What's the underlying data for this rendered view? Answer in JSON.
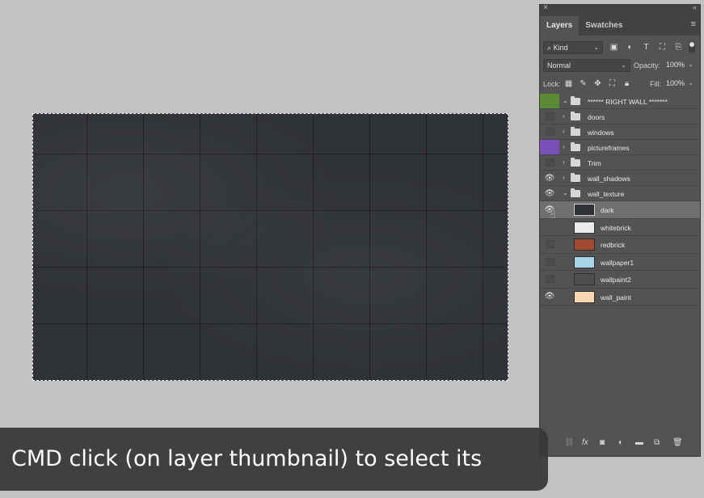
{
  "panel": {
    "close_glyph": "×",
    "collapse_glyph": "«",
    "tabs": [
      {
        "label": "Layers"
      },
      {
        "label": "Swatches"
      }
    ],
    "menu_glyph": "≡",
    "filter": {
      "label": "Kind"
    },
    "blend_mode": {
      "value": "Normal"
    },
    "opacity": {
      "label": "Opacity:",
      "value": "100%"
    },
    "lock": {
      "label": "Lock:"
    },
    "fill": {
      "label": "Fill:",
      "value": "100%"
    }
  },
  "layers": [
    {
      "name": "****** RIGHT WALL *******",
      "type": "group",
      "expanded": true,
      "visibility": "green"
    },
    {
      "name": "doors",
      "type": "group",
      "expanded": false,
      "visibility": "off"
    },
    {
      "name": "windows",
      "type": "group",
      "expanded": false,
      "visibility": "off"
    },
    {
      "name": "pictureframes",
      "type": "group",
      "expanded": false,
      "visibility": "purple"
    },
    {
      "name": "Trim",
      "type": "group",
      "expanded": false,
      "visibility": "off"
    },
    {
      "name": "wall_shadows",
      "type": "group",
      "expanded": false,
      "visibility": "on"
    },
    {
      "name": "wall_texture",
      "type": "group",
      "expanded": true,
      "visibility": "on"
    },
    {
      "name": "dark",
      "type": "layer",
      "visibility": "on",
      "selected": true,
      "thumb_color": "#2e3135"
    },
    {
      "name": "whitebrick",
      "type": "layer",
      "visibility": "off",
      "thumb_color": "#eaeaea"
    },
    {
      "name": "redbrick",
      "type": "layer",
      "visibility": "off",
      "thumb_color": "#a24b32"
    },
    {
      "name": "wallpaper1",
      "type": "layer",
      "visibility": "off",
      "thumb_color": "#a9d3e6"
    },
    {
      "name": "wallpaint2",
      "type": "layer",
      "visibility": "off",
      "thumb_color": "#4d4f4d"
    },
    {
      "name": "wall_paint",
      "type": "layer",
      "visibility": "on",
      "thumb_color": "#fbd6b0"
    }
  ],
  "caption": {
    "text": "CMD click (on layer thumbnail) to select its contents"
  }
}
